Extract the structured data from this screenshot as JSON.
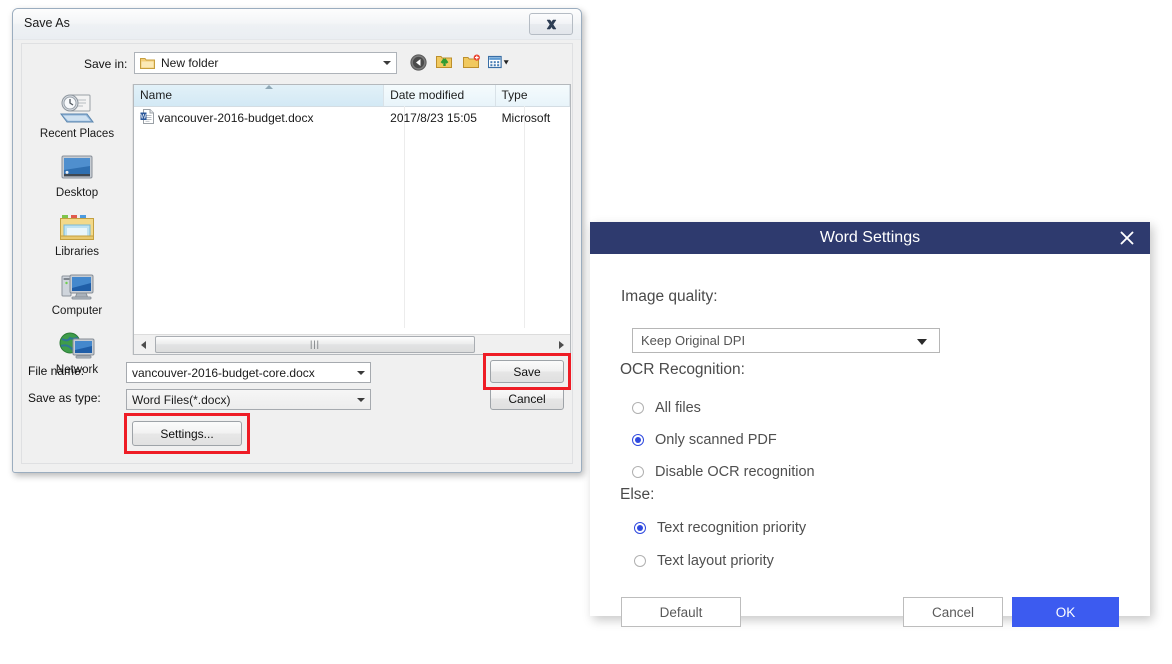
{
  "save_as_dialog": {
    "title": "Save As",
    "close_label": "Close",
    "save_in": {
      "label": "Save in:",
      "value": "New folder"
    },
    "toolbar": {
      "back": "back-navigation",
      "up": "up-one-level",
      "new_folder": "create-new-folder",
      "views": "change-view"
    },
    "places": [
      {
        "label": "Recent Places",
        "icon": "recent-places-icon"
      },
      {
        "label": "Desktop",
        "icon": "desktop-icon"
      },
      {
        "label": "Libraries",
        "icon": "libraries-icon"
      },
      {
        "label": "Computer",
        "icon": "computer-icon"
      },
      {
        "label": "Network",
        "icon": "network-icon"
      }
    ],
    "file_list": {
      "columns": [
        "Name",
        "Date modified",
        "Type"
      ],
      "sorted_column": "Name",
      "rows": [
        {
          "name": "vancouver-2016-budget.docx",
          "date_modified": "2017/8/23 15:05",
          "type": "Microsoft"
        }
      ]
    },
    "file_name": {
      "label": "File name:",
      "value": "vancouver-2016-budget-core.docx"
    },
    "save_as_type": {
      "label": "Save as type:",
      "value": "Word Files(*.docx)"
    },
    "buttons": {
      "save": "Save",
      "cancel": "Cancel",
      "settings": "Settings..."
    },
    "highlight_color": "#ee1c25"
  },
  "word_settings_dialog": {
    "title": "Word Settings",
    "close_label": "Close",
    "title_bar_color": "#2e3a6e",
    "accent_color": "#3c5bf0",
    "image_quality": {
      "label": "Image quality:",
      "selected": "Keep Original DPI"
    },
    "ocr_recognition": {
      "label": "OCR Recognition:",
      "options": [
        {
          "label": "All files",
          "selected": false
        },
        {
          "label": "Only scanned PDF",
          "selected": true
        },
        {
          "label": "Disable OCR recognition",
          "selected": false
        }
      ]
    },
    "else_section": {
      "label": "Else:",
      "options": [
        {
          "label": "Text recognition priority",
          "selected": true
        },
        {
          "label": "Text layout priority",
          "selected": false
        }
      ]
    },
    "buttons": {
      "default": "Default",
      "cancel": "Cancel",
      "ok": "OK"
    }
  }
}
